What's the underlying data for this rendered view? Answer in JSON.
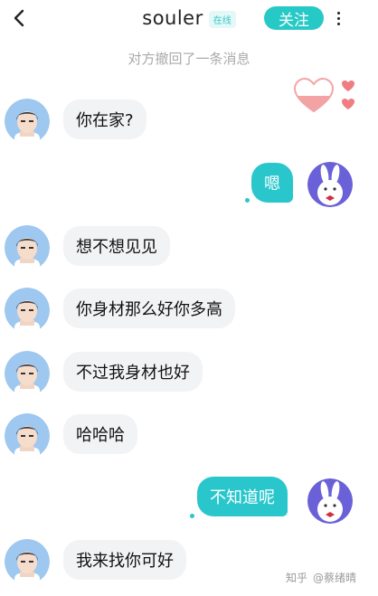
{
  "header": {
    "title": "souler",
    "status": "在线",
    "follow_label": "关注"
  },
  "notice": "对方撤回了一条消息",
  "messages": [
    {
      "side": "in",
      "text": "你在家?"
    },
    {
      "side": "out",
      "text": "嗯"
    },
    {
      "side": "in",
      "text": "想不想见见"
    },
    {
      "side": "in",
      "text": "你身材那么好你多高"
    },
    {
      "side": "in",
      "text": "不过我身材也好"
    },
    {
      "side": "in",
      "text": "哈哈哈"
    },
    {
      "side": "out",
      "text": "不知道呢"
    },
    {
      "side": "in",
      "text": "我来找你可好"
    }
  ],
  "watermark": {
    "site": "知乎",
    "author": "@蔡绪晴"
  },
  "colors": {
    "accent": "#29c7cc",
    "incoming_bubble": "#f2f3f5"
  },
  "icons": [
    "back-arrow-icon",
    "more-vertical-icon",
    "heart-icon"
  ]
}
